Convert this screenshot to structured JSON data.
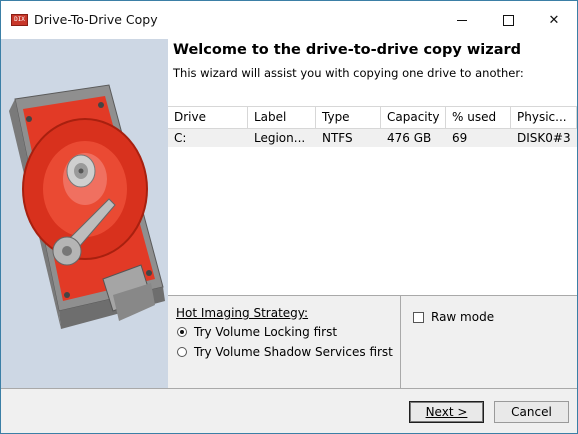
{
  "window": {
    "title": "Drive-To-Drive Copy",
    "app_icon_text": "DIX"
  },
  "wizard": {
    "heading": "Welcome to the drive-to-drive copy wizard",
    "subheading": "This wizard will assist you with copying one drive to another:"
  },
  "table": {
    "columns": [
      "Drive",
      "Label",
      "Type",
      "Capacity",
      "% used",
      "Physic..."
    ],
    "rows": [
      [
        "C:",
        "Legion...",
        "NTFS",
        "476 GB",
        "69",
        "DISK0#3"
      ]
    ]
  },
  "strategy": {
    "title": "Hot Imaging Strategy:",
    "options": [
      {
        "label": "Try Volume Locking first",
        "checked": true
      },
      {
        "label": "Try Volume Shadow Services first",
        "checked": false
      }
    ]
  },
  "raw_mode": {
    "label": "Raw mode",
    "checked": false
  },
  "buttons": {
    "next": "Next >",
    "cancel": "Cancel"
  },
  "colors": {
    "platter_red": "#e23a26",
    "side_panel": "#cdd7e4",
    "window_border": "#3b7fa6"
  }
}
